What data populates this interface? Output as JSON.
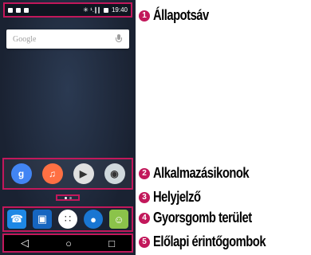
{
  "status_bar": {
    "time": "19:40",
    "signal": "✳ ¹.∥∥"
  },
  "search": {
    "placeholder": "Google"
  },
  "apps": [
    {
      "name": "google-settings-icon",
      "glyph": "g",
      "color": "#4285f4"
    },
    {
      "name": "music-icon",
      "glyph": "♫",
      "color": "#ff7043"
    },
    {
      "name": "play-store-icon",
      "glyph": "▶",
      "color": "#e0e0e0"
    },
    {
      "name": "camera-icon",
      "glyph": "◉",
      "color": "#cfd8dc"
    }
  ],
  "dock": [
    {
      "name": "phone-icon",
      "glyph": "☎",
      "color": "#1e88e5"
    },
    {
      "name": "contacts-icon",
      "glyph": "▣",
      "color": "#1565c0"
    },
    {
      "name": "app-drawer-icon",
      "glyph": "∷",
      "color": "#ffffff"
    },
    {
      "name": "browser-icon",
      "glyph": "●",
      "color": "#1976d2"
    },
    {
      "name": "messaging-icon",
      "glyph": "☺",
      "color": "#8bc34a"
    }
  ],
  "nav": {
    "back": "◁",
    "home": "○",
    "recents": "□"
  },
  "callouts": [
    {
      "num": "1",
      "label": "Állapotsáv"
    },
    {
      "num": "2",
      "label": "Alkalmazásikonok"
    },
    {
      "num": "3",
      "label": "Helyjelző"
    },
    {
      "num": "4",
      "label": "Gyorsgomb terület"
    },
    {
      "num": "5",
      "label": "Előlapi érintőgombok"
    }
  ]
}
